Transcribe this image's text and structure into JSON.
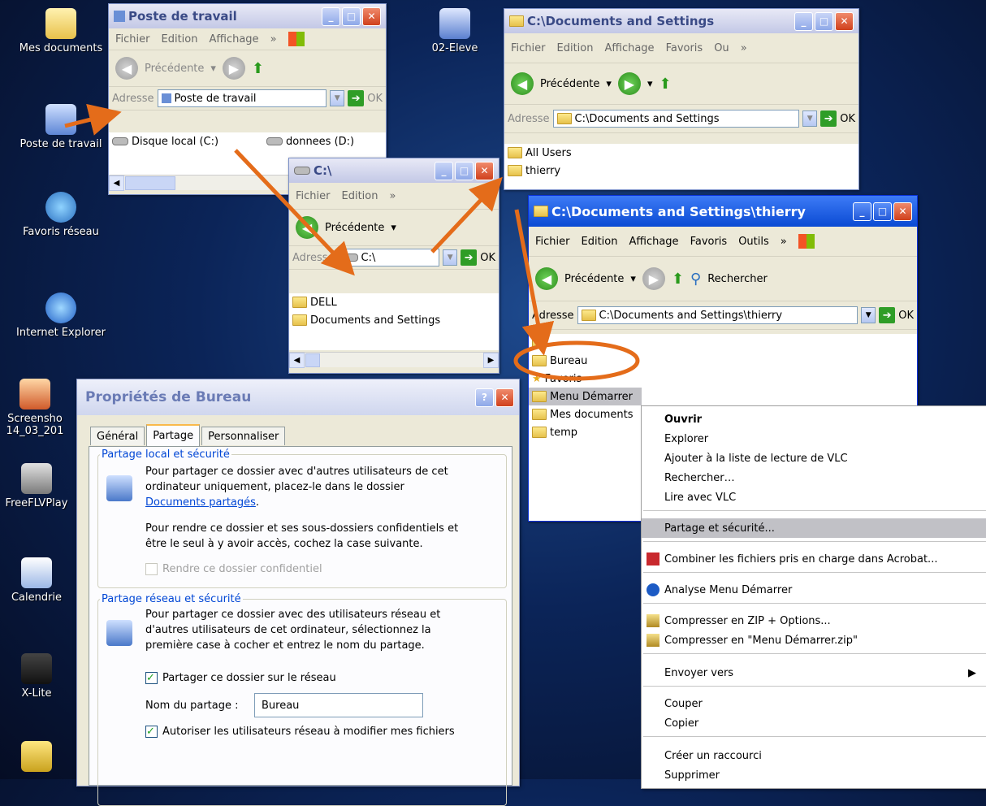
{
  "desktop": {
    "icons": [
      "Mes documents",
      "Poste de travail",
      "Favoris réseau",
      "Internet Explorer",
      "Screensho 14_03_201",
      "FreeFLVPlay",
      "Calendrie",
      "X-Lite"
    ],
    "shortcut_label": "02-Eleve"
  },
  "win_poste": {
    "title": "Poste de travail",
    "menus": [
      "Fichier",
      "Edition",
      "Affichage"
    ],
    "back_label": "Précédente",
    "address_label": "Adresse",
    "address_value": "Poste de travail",
    "ok": "OK",
    "items": [
      "Disque local (C:)",
      "donnees (D:)"
    ]
  },
  "win_c": {
    "title": "C:\\",
    "menus": [
      "Fichier",
      "Edition"
    ],
    "back_label": "Précédente",
    "address_label": "Adresse",
    "address_value": "C:\\",
    "ok": "OK",
    "items": [
      "DELL",
      "Documents and Settings"
    ]
  },
  "win_docs": {
    "title": "C:\\Documents and Settings",
    "menus": [
      "Fichier",
      "Edition",
      "Affichage",
      "Favoris",
      "Ou"
    ],
    "back_label": "Précédente",
    "address_label": "Adresse",
    "address_value": "C:\\Documents and Settings",
    "ok": "OK",
    "items": [
      "All Users",
      "thierry"
    ]
  },
  "win_thierry": {
    "title": "C:\\Documents and Settings\\thierry",
    "menus": [
      "Fichier",
      "Edition",
      "Affichage",
      "Favoris",
      "Outils"
    ],
    "back_label": "Précédente",
    "search_label": "Rechercher",
    "address_label": "Adresse",
    "address_value": "C:\\Documents and Settings\\thierry",
    "ok": "OK",
    "items": [
      "Bureau",
      "Favoris",
      "Menu Démarrer",
      "Mes documents",
      "temp"
    ]
  },
  "dialog": {
    "title": "Propriétés de Bureau",
    "tabs": [
      "Général",
      "Partage",
      "Personnaliser"
    ],
    "local_group": "Partage local et sécurité",
    "local_text": "Pour partager ce dossier avec d'autres utilisateurs de cet ordinateur uniquement, placez-le dans le dossier",
    "local_link": "Documents partagés",
    "private_text": "Pour rendre ce dossier et ses sous-dossiers confidentiels et être le seul à y avoir accès, cochez la case suivante.",
    "private_check": "Rendre ce dossier confidentiel",
    "net_group": "Partage réseau et sécurité",
    "net_text": "Pour partager ce dossier avec des utilisateurs réseau et d'autres utilisateurs de cet ordinateur, sélectionnez la première case à cocher et entrez le nom du partage.",
    "share_check": "Partager ce dossier sur le réseau",
    "share_name_label": "Nom du partage :",
    "share_name_value": "Bureau",
    "allow_check": "Autoriser les utilisateurs réseau à modifier mes fichiers"
  },
  "context_menu": {
    "items": [
      "Ouvrir",
      "Explorer",
      "Ajouter à la liste de lecture de VLC",
      "Rechercher…",
      "Lire avec VLC",
      "Partage et sécurité...",
      "Combiner les fichiers pris en charge dans Acrobat...",
      "Analyse Menu Démarrer",
      "Compresser en ZIP + Options...",
      "Compresser en \"Menu Démarrer.zip\"",
      "Envoyer vers",
      "Couper",
      "Copier",
      "Créer un raccourci",
      "Supprimer"
    ]
  },
  "colors": {
    "annotation": "#e46c1a",
    "xp_blue": "#0a4ad3",
    "menu_highlight": "#c1c1c6"
  }
}
